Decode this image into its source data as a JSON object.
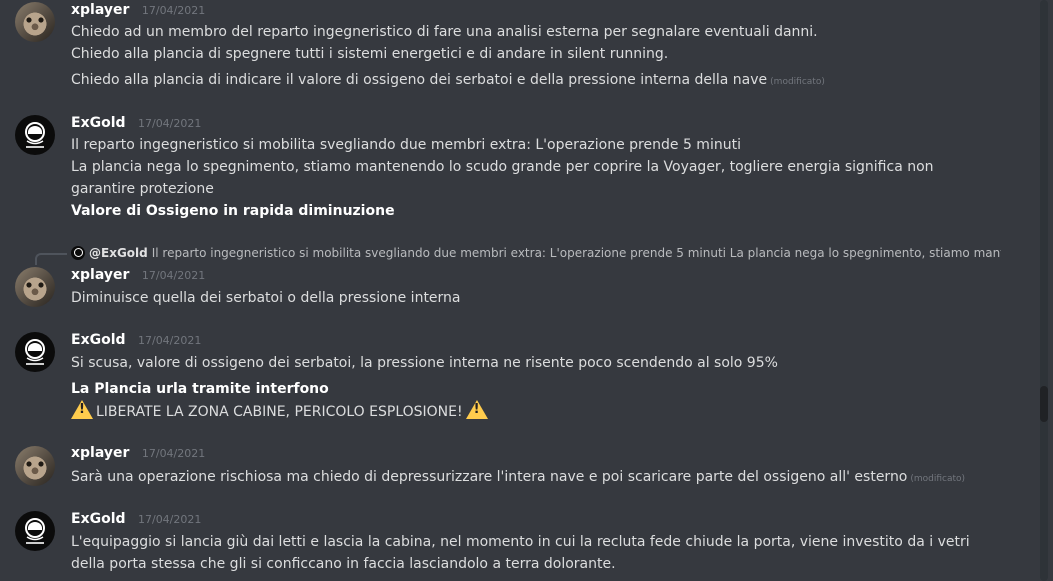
{
  "messages": [
    {
      "user": "xplayer",
      "timestamp": "17/04/2021",
      "avatar": "cat-avatar",
      "lines": [
        "Chiedo ad un membro del reparto ingegneristico di fare una analisi esterna per segnalare eventuali danni.",
        "Chiedo alla plancia di spegnere tutti i sistemi energetici e di andare in silent running.",
        "Chiedo alla plancia di indicare il valore di ossigeno dei serbatoi e della pressione interna della nave"
      ],
      "edited_label": "(modificato)"
    },
    {
      "user": "ExGold",
      "timestamp": "17/04/2021",
      "avatar": "exgold-logo-avatar",
      "lines": [
        "Il reparto ingegneristico si mobilita svegliando due membri extra: L'operazione prende 5 minuti",
        "La plancia nega lo spegnimento, stiamo mantenendo lo scudo grande per coprire la Voyager, togliere energia significa non garantire protezione",
        "Valore di Ossigeno in rapida diminuzione"
      ]
    },
    {
      "reply": {
        "user": "@ExGold",
        "text": "Il reparto ingegneristico si mobilita svegliando due membri extra: L'operazione prende 5 minuti  La plancia nega lo spegnimento, stiamo manten…"
      },
      "user": "xplayer",
      "timestamp": "17/04/2021",
      "avatar": "cat-avatar",
      "lines": [
        "Diminuisce quella dei serbatoi o della pressione interna"
      ]
    },
    {
      "user": "ExGold",
      "timestamp": "17/04/2021",
      "avatar": "exgold-logo-avatar",
      "lines": [
        "Si scusa, valore di ossigeno dei serbatoi, la pressione interna ne risente poco scendendo al solo 95%",
        "La Plancia urla tramite interfono",
        "LIBERATE LA ZONA CABINE, PERICOLO ESPLOSIONE!"
      ],
      "emoji": "warning-icon"
    },
    {
      "user": "xplayer",
      "timestamp": "17/04/2021",
      "avatar": "cat-avatar",
      "lines": [
        "Sarà una operazione rischiosa ma chiedo di depressurizzare l'intera nave e poi scaricare parte del ossigeno all' esterno"
      ],
      "edited_label": "(modificato)"
    },
    {
      "user": "ExGold",
      "timestamp": "17/04/2021",
      "avatar": "exgold-logo-avatar",
      "lines": [
        "L'equipaggio si lancia giù dai letti e lascia la cabina, nel momento in cui la recluta fede chiude la porta, viene investito da i vetri della porta stessa che gli si conficcano in faccia lasciandolo a terra dolorante."
      ]
    }
  ],
  "colors": {
    "background": "#36393f",
    "text": "#dcddde",
    "username": "#ffffff",
    "timestamp": "#72767d",
    "warning": "#ffcc4d"
  }
}
